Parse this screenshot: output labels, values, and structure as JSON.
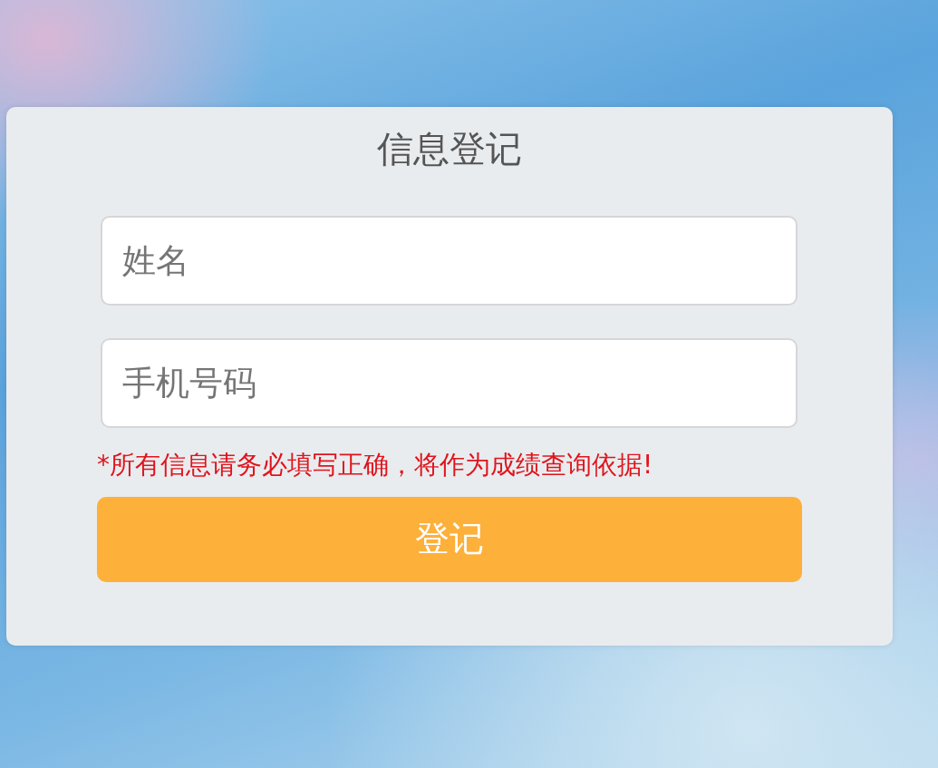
{
  "title": "信息登记",
  "fields": [
    {
      "placeholder": "姓名"
    },
    {
      "placeholder": "手机号码"
    }
  ],
  "notice": "*所有信息请务必填写正确，将作为成绩查询依据!",
  "submit_button": "登记"
}
